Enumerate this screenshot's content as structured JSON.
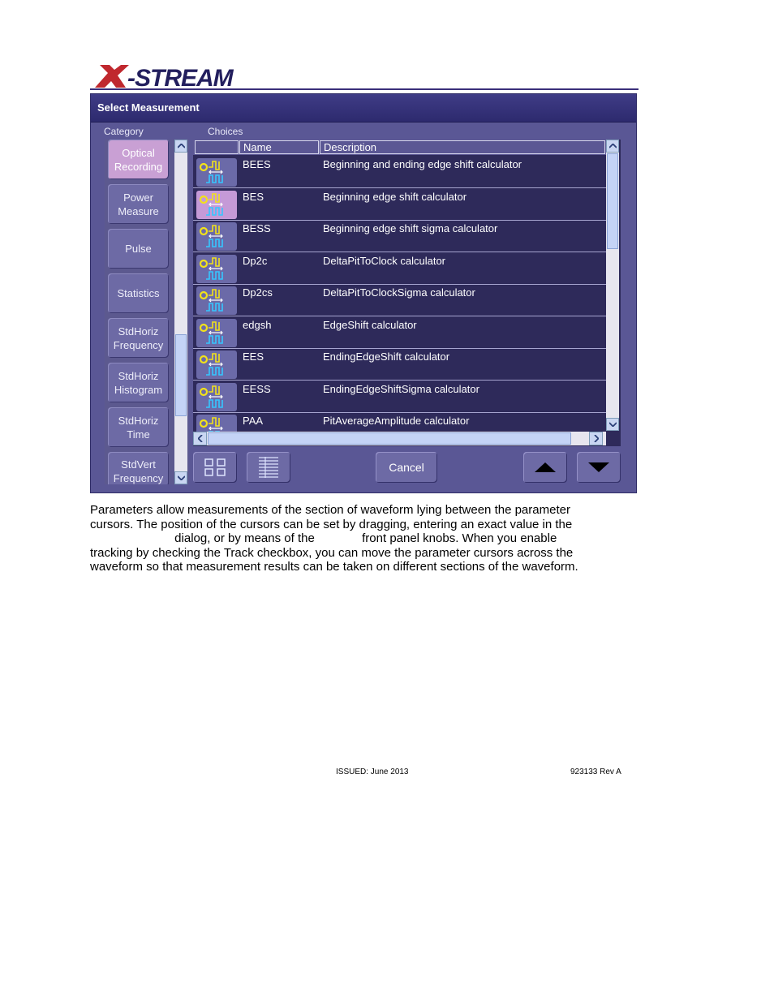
{
  "logo": {
    "text": "X-STREAM",
    "colors": {
      "x": "#c0282e",
      "stream": "#231f5e"
    }
  },
  "dialog": {
    "title": "Select Measurement",
    "category_label": "Category",
    "choices_label": "Choices",
    "categories": [
      {
        "label": "Optical Recording",
        "selected": true
      },
      {
        "label": "Power Measure",
        "selected": false
      },
      {
        "label": "Pulse",
        "selected": false
      },
      {
        "label": "Statistics",
        "selected": false
      },
      {
        "label": "StdHoriz Frequency",
        "selected": false
      },
      {
        "label": "StdHoriz Histogram",
        "selected": false
      },
      {
        "label": "StdHoriz Time",
        "selected": false
      },
      {
        "label": "StdVert Frequency",
        "selected": false
      }
    ],
    "columns": {
      "name": "Name",
      "description": "Description"
    },
    "rows": [
      {
        "name": "BEES",
        "description": "Beginning and ending edge shift calculator",
        "icon": "bees-waveform-icon",
        "highlighted": false
      },
      {
        "name": "BES",
        "description": "Beginning edge shift calculator",
        "icon": "bes-waveform-icon",
        "highlighted": true
      },
      {
        "name": "BESS",
        "description": "Beginning edge shift sigma  calculator",
        "icon": "bess-waveform-icon",
        "highlighted": false
      },
      {
        "name": "Dp2c",
        "description": "DeltaPitToClock  calculator",
        "icon": "dp2c-waveform-icon",
        "highlighted": false
      },
      {
        "name": "Dp2cs",
        "description": "DeltaPitToClockSigma calculator",
        "icon": "dp2cs-waveform-icon",
        "highlighted": false
      },
      {
        "name": "edgsh",
        "description": "EdgeShift calculator",
        "icon": "edgsh-waveform-icon",
        "highlighted": false
      },
      {
        "name": "EES",
        "description": "EndingEdgeShift calculator",
        "icon": "ees-waveform-icon",
        "highlighted": false
      },
      {
        "name": "EESS",
        "description": "EndingEdgeShiftSigma calculator",
        "icon": "eess-waveform-icon",
        "highlighted": false
      },
      {
        "name": "PAA",
        "description": "PitAverageAmplitude calculator",
        "icon": "paa-waveform-icon",
        "highlighted": false
      }
    ],
    "buttons": {
      "cancel": "Cancel"
    }
  },
  "paragraph": [
    "Parameters allow measurements of the section of waveform lying between the parameter",
    "cursors. The position of the cursors can be set by dragging, entering an exact value in the",
    "                         dialog, or by means of the              front panel knobs. When you enable",
    "tracking by checking the Track checkbox, you can move the parameter cursors across the",
    "waveform so that measurement results can be taken on different sections of the waveform."
  ],
  "footer": {
    "issued": "ISSUED: June 2013",
    "doc_number": "923133 Rev A"
  }
}
